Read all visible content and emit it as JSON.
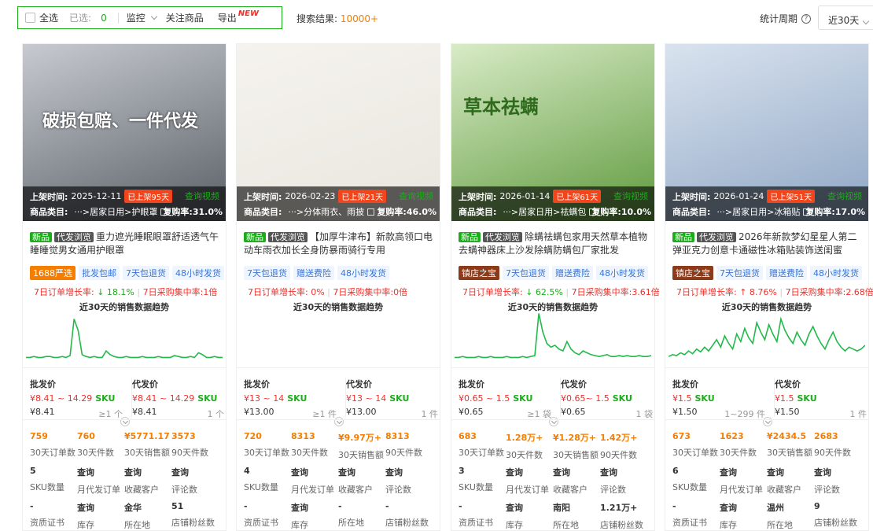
{
  "toolbar": {
    "select_all": "全选",
    "selected_label": "已选:",
    "selected_count": "0",
    "monitor": "监控",
    "follow": "关注商品",
    "export": "导出",
    "export_badge": "NEW",
    "search_label": "搜索结果:",
    "search_count": "10000+",
    "stat_period_label": "统计周期",
    "period": "近30天"
  },
  "labels": {
    "listed": "上架时间:",
    "category": "商品类目:",
    "video": "查询视频",
    "trend_title": "近30天的销售数据趋势",
    "wholesale": "批发价",
    "dropship": "代发价",
    "stats": [
      "30天订单数",
      "30天件数",
      "30天销售额",
      "90天件数",
      "SKU数量",
      "月代发订单",
      "收藏客户",
      "评论数",
      "资质证书",
      "库存",
      "所在地",
      "店铺粉丝数"
    ],
    "order_growth": "7日订单增长率:",
    "purchase_conc": "7日采购集中率:"
  },
  "cards": [
    {
      "date": "2025-12-11",
      "age": "已上架95天",
      "category": "···>居家日用>护眼罩",
      "rebuy": "复购率:31.0%",
      "img_text": "破损包赔、一件代发",
      "tags": [
        "新品",
        "代发浏览"
      ],
      "title": "重力遮光睡眠眼罩舒适透气午睡睡觉男女通用护眼罩",
      "services": [
        {
          "t": "1688严选",
          "k": "brand"
        },
        {
          "t": "批发包邮",
          "k": "svc"
        },
        {
          "t": "7天包退货",
          "k": "svc"
        },
        {
          "t": "48小时发货",
          "k": "svc"
        }
      ],
      "growth": "↓ 18.1%",
      "growth_dir": "down",
      "conc": "1倍",
      "wholesale_range": "¥8.41 ~ 14.29",
      "dropship_range": "¥8.41 ~ 14.29",
      "sku": "SKU",
      "wholesale_min": "¥8.41",
      "wholesale_moq": "≥1 个",
      "dropship_min": "¥8.41",
      "dropship_moq": "1 个",
      "stats": [
        "759",
        "760",
        "¥5771.17",
        "3573",
        "5",
        "查询",
        "查询",
        "查询",
        "-",
        "查询",
        "金华",
        "51"
      ],
      "trend": [
        3,
        3,
        4,
        3,
        3,
        4,
        4,
        3,
        3,
        4,
        3,
        5,
        44,
        32,
        6,
        4,
        3,
        4,
        3,
        3,
        10,
        6,
        4,
        3,
        3,
        4,
        3,
        3,
        3,
        4,
        3,
        3,
        3,
        4,
        3,
        3,
        3,
        5,
        4,
        3,
        3,
        4,
        3,
        8,
        6,
        3,
        3,
        4,
        3,
        3
      ],
      "colors": {
        "bg1": "#5a5f66",
        "bg2": "#c7cbd1"
      }
    },
    {
      "date": "2026-02-23",
      "age": "已上架21天",
      "category": "···>分体雨衣、雨披",
      "rebuy": "复购率:46.0%",
      "img_text": "",
      "tags": [
        "新品",
        "代发浏览"
      ],
      "title": "【加厚牛津布】新款高领口电动车雨衣加长全身防暴雨骑行专用",
      "services": [
        {
          "t": "7天包退货",
          "k": "svc"
        },
        {
          "t": "赠送费险",
          "k": "svc"
        },
        {
          "t": "48小时发货",
          "k": "svc"
        }
      ],
      "growth": "0%",
      "growth_dir": "flat",
      "conc": "0倍",
      "wholesale_range": "¥13 ~ 14",
      "dropship_range": "¥13 ~ 14",
      "sku": "SKU",
      "wholesale_min": "¥13.00",
      "wholesale_moq": "≥1 件",
      "dropship_min": "¥13.00",
      "dropship_moq": "1 件",
      "stats": [
        "720",
        "8313",
        "¥9.97万+",
        "8313",
        "4",
        "查询",
        "查询",
        "查询",
        "-",
        "查询",
        "-",
        "-"
      ],
      "trend": [],
      "colors": {
        "bg1": "#e9e6df",
        "bg2": "#f5f3ee"
      }
    },
    {
      "date": "2026-01-14",
      "age": "已上架61天",
      "category": "···>居家日用>祛螨包",
      "rebuy": "复购率:10.0%",
      "img_text": "草本祛螨",
      "tags": [
        "新品",
        "代发浏览"
      ],
      "title": "除螨祛螨包家用天然草本植物去螨神器床上沙发除螨防螨包厂家批发",
      "services": [
        {
          "t": "镇店之宝",
          "k": "shop"
        },
        {
          "t": "7天包退货",
          "k": "svc"
        },
        {
          "t": "赠送费险",
          "k": "svc"
        },
        {
          "t": "48小时发货",
          "k": "svc"
        }
      ],
      "growth": "↓ 62.5%",
      "growth_dir": "down",
      "conc": "3.61倍",
      "wholesale_range": "¥0.65 ~ 1.5",
      "dropship_range": "¥0.65~ 1.5",
      "sku": "SKU",
      "wholesale_min": "¥0.65",
      "wholesale_moq": "≥1 袋",
      "dropship_min": "¥0.65",
      "dropship_moq": "1 袋",
      "stats": [
        "683",
        "1.28万+",
        "¥1.28万+",
        "1.42万+",
        "3",
        "查询",
        "查询",
        "查询",
        "-",
        "查询",
        "南阳",
        "1.21万+"
      ],
      "trend": [
        3,
        3,
        4,
        3,
        3,
        3,
        4,
        3,
        3,
        4,
        3,
        3,
        3,
        4,
        3,
        3,
        3,
        4,
        3,
        4,
        5,
        50,
        30,
        18,
        14,
        16,
        12,
        10,
        20,
        12,
        8,
        6,
        10,
        8,
        6,
        5,
        4,
        5,
        6,
        4,
        4,
        5,
        4,
        5,
        4,
        4,
        5,
        4,
        4,
        5
      ],
      "colors": {
        "bg1": "#5f9a3e",
        "bg2": "#d8ebc6"
      }
    },
    {
      "date": "2026-01-24",
      "age": "已上架51天",
      "category": "···>居家日用>冰箱贴",
      "rebuy": "复购率:17.0%",
      "img_text": "",
      "tags": [
        "新品",
        "代发浏览"
      ],
      "title": "2026年新款梦幻星星人第二弹亚克力创意卡通磁性冰箱贴装饰送闺蜜",
      "services": [
        {
          "t": "镇店之宝",
          "k": "shop"
        },
        {
          "t": "7天包退货",
          "k": "svc"
        },
        {
          "t": "赠送费险",
          "k": "svc"
        },
        {
          "t": "48小时发货",
          "k": "svc"
        }
      ],
      "growth": "↑ 8.76%",
      "growth_dir": "up",
      "conc": "2.68倍",
      "wholesale_range": "¥1.5",
      "dropship_range": "¥1.5",
      "sku": "SKU",
      "wholesale_min": "¥1.50",
      "wholesale_moq": "1~299 件",
      "dropship_min": "¥1.50",
      "dropship_moq": "1 件",
      "stats": [
        "673",
        "1623",
        "¥2434.5",
        "2683",
        "6",
        "查询",
        "查询",
        "查询",
        "-",
        "查询",
        "温州",
        "9"
      ],
      "trend": [
        4,
        6,
        5,
        8,
        6,
        10,
        7,
        12,
        9,
        14,
        10,
        16,
        22,
        14,
        26,
        18,
        12,
        28,
        20,
        34,
        24,
        18,
        40,
        30,
        22,
        38,
        28,
        20,
        44,
        32,
        24,
        18,
        30,
        22,
        16,
        28,
        36,
        26,
        18,
        12,
        22,
        30,
        20,
        14,
        10,
        14,
        12,
        10,
        12,
        16
      ],
      "colors": {
        "bg1": "#8fa6c4",
        "bg2": "#d9e3ef"
      }
    }
  ]
}
